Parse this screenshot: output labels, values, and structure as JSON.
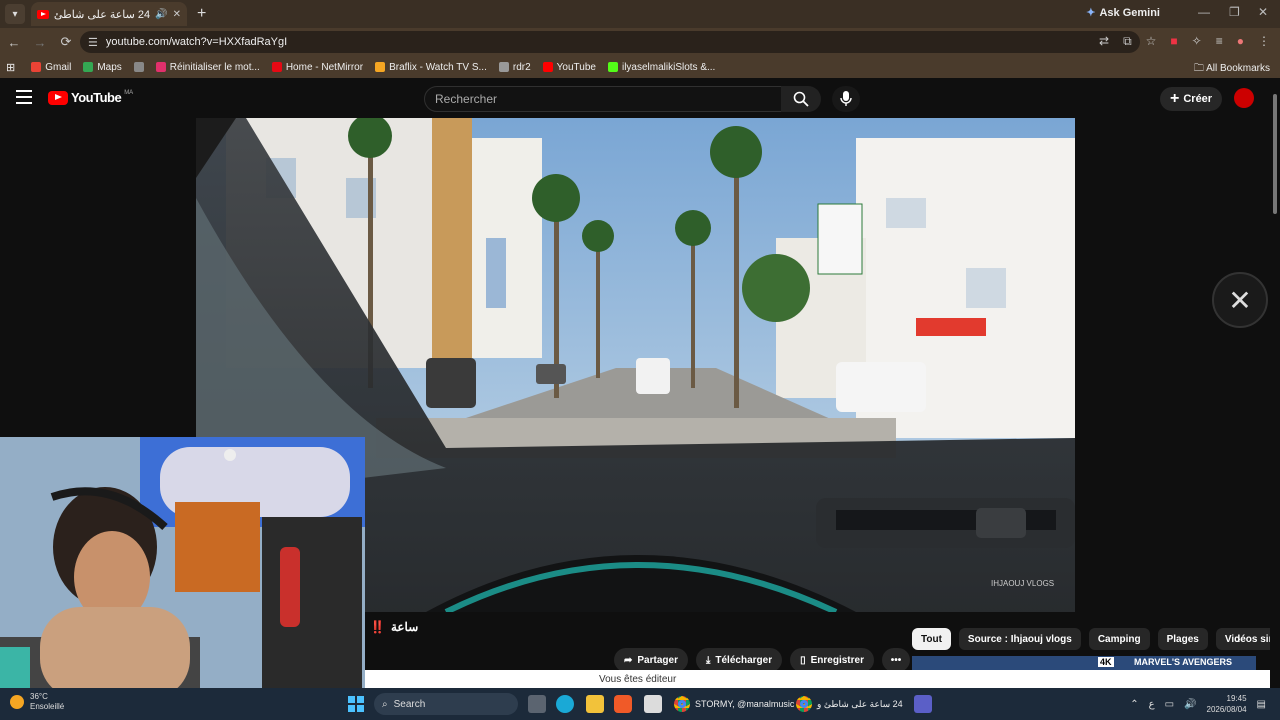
{
  "browser": {
    "tab_title": "24 ساعة على شاطئ واد",
    "ask_gemini": "Ask Gemini",
    "url": "youtube.com/watch?v=HXXfadRaYgI",
    "bookmarks": [
      {
        "label": "Gmail",
        "color": "#ea4335"
      },
      {
        "label": "Maps",
        "color": "#34a853"
      },
      {
        "label": "",
        "color": "#888888"
      },
      {
        "label": "Réinitialiser le mot...",
        "color": "#e1306c"
      },
      {
        "label": "Home - NetMirror",
        "color": "#e50914"
      },
      {
        "label": "Braflix - Watch TV S...",
        "color": "#f5a623"
      },
      {
        "label": "rdr2",
        "color": "#999999"
      },
      {
        "label": "YouTube",
        "color": "#ff0000"
      },
      {
        "label": "ilyaselmalikiSlots &...",
        "color": "#53fc18"
      }
    ],
    "all_bookmarks": "All Bookmarks"
  },
  "youtube": {
    "logo_text": "YouTube",
    "country": "MA",
    "search_placeholder": "Rechercher",
    "create_label": "Créer",
    "video_watermark": "IHJAOUJ VLOGS",
    "title_visible": "ساعة",
    "title_emoji": "‼️",
    "actions": {
      "share": "Partager",
      "download": "Télécharger",
      "save": "Enregistrer"
    },
    "chips": [
      "Tout",
      "Source : Ihjaouj vlogs",
      "Camping",
      "Plages",
      "Vidéos sin"
    ],
    "thumb_badge": "4K",
    "thumb_text": "MARVEL'S AVENGERS",
    "editor_notice": "Vous êtes éditeur"
  },
  "taskbar": {
    "weather_temp": "36°C",
    "weather_desc": "Ensoleillé",
    "search_label": "Search",
    "window1": "STORMY, @manalmusic",
    "window2": "24 ساعة على شاطئ و",
    "time": "19:45",
    "date": "2026/08/04"
  },
  "colors": {
    "accent_red": "#ff0000",
    "windows_blue": "#4cc2ff"
  }
}
